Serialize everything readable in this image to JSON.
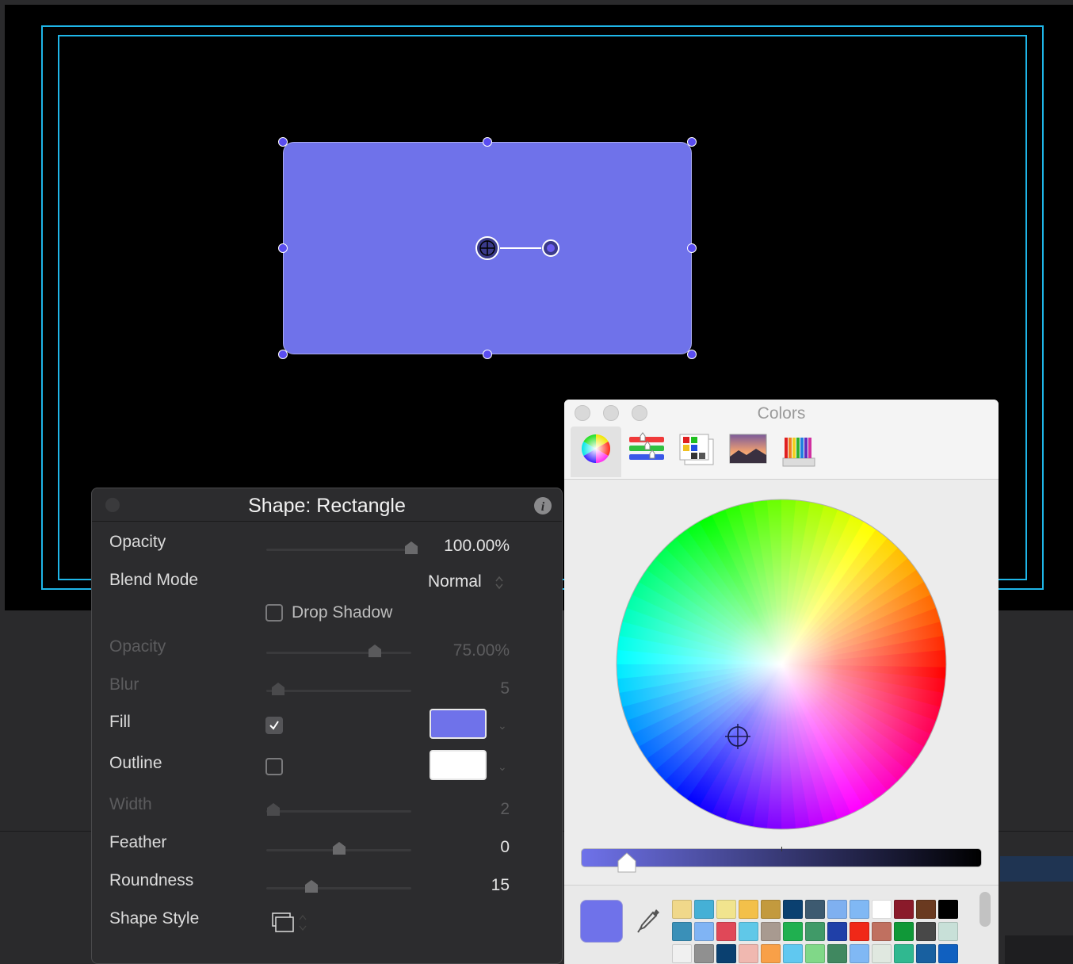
{
  "canvas": {
    "guide_color": "#1fb6e8",
    "shape_fill": "#6f72ea"
  },
  "inspector": {
    "title": "Shape: Rectangle",
    "info_icon": "info-icon",
    "opacity": {
      "label": "Opacity",
      "value": "100.00%",
      "level": 1.0
    },
    "blend_mode": {
      "label": "Blend Mode",
      "value": "Normal"
    },
    "drop_shadow": {
      "label": "Drop Shadow",
      "checked": false
    },
    "shadow_opacity": {
      "label": "Opacity",
      "value": "75.00%",
      "level": 0.75
    },
    "blur": {
      "label": "Blur",
      "value": "5",
      "level": 0.08
    },
    "fill": {
      "label": "Fill",
      "checked": true,
      "color": "#6f72ea"
    },
    "outline": {
      "label": "Outline",
      "checked": false,
      "color": "#ffffff"
    },
    "width": {
      "label": "Width",
      "value": "2",
      "level": 0.05
    },
    "feather": {
      "label": "Feather",
      "value": "0",
      "level": 0.5
    },
    "roundness": {
      "label": "Roundness",
      "value": "15",
      "level": 0.31
    },
    "shape_style": {
      "label": "Shape Style",
      "icon": "shape-style-icon"
    }
  },
  "colors_panel": {
    "title": "Colors",
    "modes": [
      "color-wheel-icon",
      "color-sliders-icon",
      "color-palettes-icon",
      "image-palettes-icon",
      "pencils-icon"
    ],
    "current_color": "#6f72ea",
    "brightness": 0.12,
    "swatches": [
      [
        "#f0d88a",
        "#45b0d6",
        "#f1e48e",
        "#f3c04a",
        "#c39a3e",
        "#0a4070",
        "#3d5a70",
        "#7fb0f0",
        "#80b8f4",
        "#ffffff",
        "#8a1a2a",
        "#6a3a20",
        "#000000"
      ],
      [
        "#3a90b8",
        "#80b4f4",
        "#e04858",
        "#60c8e8",
        "#a89a90",
        "#20b050",
        "#409a68",
        "#2040a8",
        "#f02818",
        "#c07060",
        "#109838",
        "#484848",
        "#c8e0d8"
      ],
      [
        "#f0f0f0",
        "#909090",
        "#0a4070",
        "#f0b8b0",
        "#f8a048",
        "#60c8f0",
        "#80d888",
        "#408860",
        "#80b8f4",
        "#e0e8e0",
        "#30b890",
        "#1860a0",
        "#1060c0"
      ]
    ]
  }
}
